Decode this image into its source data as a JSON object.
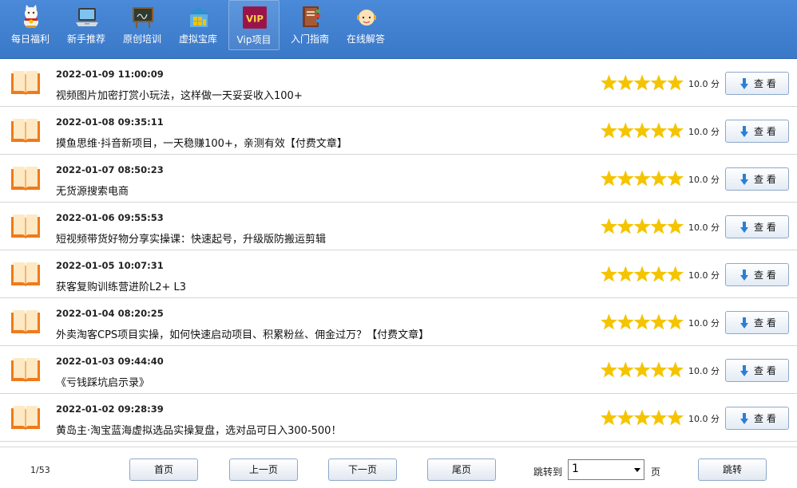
{
  "nav": {
    "items": [
      {
        "label": "每日福利",
        "icon": "lucky-cat-icon"
      },
      {
        "label": "新手推荐",
        "icon": "laptop-icon"
      },
      {
        "label": "原创培训",
        "icon": "blackboard-icon"
      },
      {
        "label": "虚拟宝库",
        "icon": "treasure-house-icon"
      },
      {
        "label": "Vip项目",
        "icon": "vip-icon",
        "badge": "VIP"
      },
      {
        "label": "入门指南",
        "icon": "guide-book-icon"
      },
      {
        "label": "在线解答",
        "icon": "support-agent-icon"
      }
    ],
    "active_index": 4
  },
  "articles": [
    {
      "date": "2022-01-09 11:00:09",
      "title": "视频图片加密打赏小玩法，这样做一天妥妥收入100+",
      "rating": 5,
      "score": "10.0 分",
      "view_label": "查 看"
    },
    {
      "date": "2022-01-08 09:35:11",
      "title": "摸鱼思维·抖音新项目，一天稳赚100+，亲测有效【付费文章】",
      "rating": 5,
      "score": "10.0 分",
      "view_label": "查 看"
    },
    {
      "date": "2022-01-07 08:50:23",
      "title": "无货源搜索电商",
      "rating": 5,
      "score": "10.0 分",
      "view_label": "查 看"
    },
    {
      "date": "2022-01-06 09:55:53",
      "title": "短视频带货好物分享实操课：快速起号，升级版防搬运剪辑",
      "rating": 5,
      "score": "10.0 分",
      "view_label": "查 看"
    },
    {
      "date": "2022-01-05 10:07:31",
      "title": "获客复购训练营进阶L2+ L3",
      "rating": 5,
      "score": "10.0 分",
      "view_label": "查 看"
    },
    {
      "date": "2022-01-04 08:20:25",
      "title": "外卖淘客CPS项目实操，如何快速启动项目、积累粉丝、佣金过万？【付费文章】",
      "rating": 5,
      "score": "10.0 分",
      "view_label": "查 看"
    },
    {
      "date": "2022-01-03 09:44:40",
      "title": "《亏钱踩坑启示录》",
      "rating": 5,
      "score": "10.0 分",
      "view_label": "查 看"
    },
    {
      "date": "2022-01-02 09:28:39",
      "title": "黄岛主·淘宝蓝海虚拟选品实操复盘，选对品可日入300-500！",
      "rating": 5,
      "score": "10.0 分",
      "view_label": "查 看"
    }
  ],
  "pager": {
    "page_info": "1/53",
    "first_label": "首页",
    "prev_label": "上一页",
    "next_label": "下一页",
    "last_label": "尾页",
    "jump_label": "跳转到",
    "jump_value": "1",
    "page_unit": "页",
    "go_label": "跳转"
  },
  "colors": {
    "nav_bg": "#3a78c8",
    "star": "#f5c400",
    "book": "#f07a1a",
    "button_border": "#8ea8c7",
    "arrow": "#2b7fd6"
  }
}
